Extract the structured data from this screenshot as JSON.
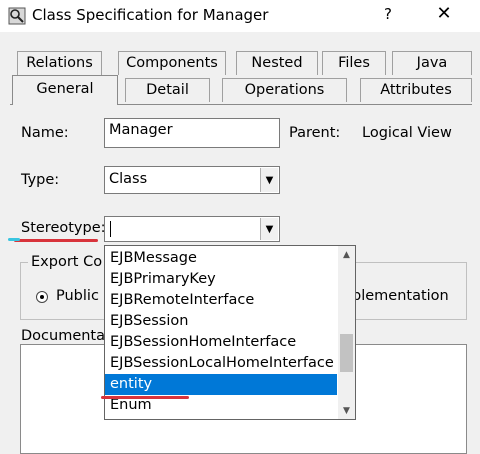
{
  "window": {
    "title": "Class Specification for Manager",
    "help_label": "?",
    "close_label": "✕"
  },
  "tabs": {
    "row_back": [
      "Relations",
      "Components",
      "Nested",
      "Files",
      "Java"
    ],
    "row_front": [
      "General",
      "Detail",
      "Operations",
      "Attributes"
    ],
    "active": "General"
  },
  "form": {
    "name_label": "Name:",
    "name_value": "Manager",
    "parent_label": "Parent:",
    "parent_value": "Logical View",
    "type_label": "Type:",
    "type_value": "Class",
    "stereotype_label": "Stereotype:",
    "stereotype_value": "",
    "export_label": "Export Co",
    "export_option": "Public",
    "implementation_label": "plementation",
    "documentation_label": "Documentat"
  },
  "dropdown": {
    "items": [
      "EJBMessage",
      "EJBPrimaryKey",
      "EJBRemoteInterface",
      "EJBSession",
      "EJBSessionHomeInterface",
      "EJBSessionLocalHomeInterface",
      "entity",
      "Enum"
    ],
    "selected": "entity"
  },
  "colors": {
    "selection": "#0078d7",
    "annotation_red": "#d8333b",
    "annotation_cyan": "#39c5e0"
  }
}
